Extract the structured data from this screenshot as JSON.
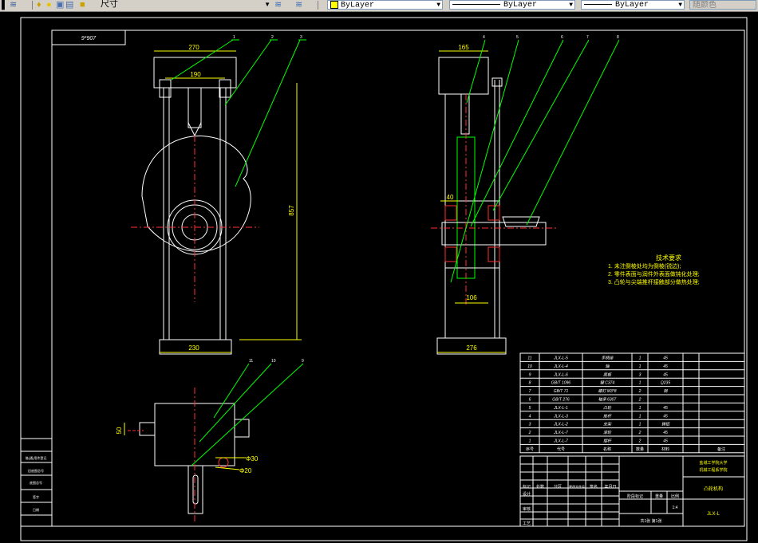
{
  "toolbar": {
    "layer_name": "尺寸",
    "color": "ByLayer",
    "linetype": "ByLayer",
    "lineweight": "ByLayer",
    "plotstyle": "随颜色"
  },
  "drawing": {
    "sheet_label": "9*907",
    "dims": {
      "front_width_top": "270",
      "front_inner": "190",
      "front_height": "857",
      "front_base": "230",
      "side_top": "165",
      "side_shaft": "40",
      "side_lower": "106",
      "side_base": "276",
      "bottom_left": "50",
      "bottom_d30": "Φ30",
      "bottom_d20": "Φ20"
    },
    "balloons_front": [
      "1",
      "2",
      "3"
    ],
    "balloons_side": [
      "4",
      "5",
      "6",
      "7",
      "8"
    ],
    "balloons_bottom": [
      "11",
      "10",
      "9"
    ],
    "notes_title": "技术要求",
    "notes": [
      "1. 未注倒棱处均为倒棱(锐边);",
      "2. 零件表面与润件外表面做钝化处理;",
      "3. 凸轮与尖端推杆接触部分做热处理;"
    ],
    "parts": [
      [
        "11",
        "JLX-L-5",
        "手柄座",
        "1",
        "45"
      ],
      [
        "10",
        "JLX-L-4",
        "轴",
        "1",
        "45"
      ],
      [
        "9",
        "JLX-L-6",
        "底板",
        "3",
        "45"
      ],
      [
        "8",
        "GB/T 1096",
        "键 C374",
        "1",
        "Q235"
      ],
      [
        "7",
        "GB/T 71",
        "螺钉 M3*8",
        "2",
        "钢"
      ],
      [
        "6",
        "GB/T 276",
        "轴承 6307",
        "2",
        ""
      ],
      [
        "5",
        "JLX-L-1",
        "凸轮",
        "1",
        "45"
      ],
      [
        "4",
        "JLX-L-3",
        "推杆",
        "1",
        "45"
      ],
      [
        "3",
        "JLX-L-2",
        "支架",
        "1",
        "铸铝"
      ],
      [
        "2",
        "JLX-L-7",
        "滚轮",
        "2",
        "45"
      ],
      [
        "1",
        "JLX-L-7",
        "摆杆",
        "2",
        "45"
      ]
    ],
    "parts_header": [
      "序号",
      "代号",
      "名称",
      "数量",
      "材料",
      "",
      "备注"
    ],
    "title_left": [
      "标记",
      "处数",
      "分区",
      "更改文件号",
      "签名",
      "年月日"
    ],
    "title_rows": [
      "设计",
      "审核",
      "工艺"
    ],
    "school": "盐城工学院大学",
    "school2": "机械工程系学院",
    "drawing_name": "凸轮机构",
    "drawing_code": "JLX-L",
    "stage": "阶段标记",
    "weight": "重量",
    "scale": "比例",
    "scale_val": "1:4",
    "sheets": "共1张 第1张",
    "left_strip": [
      "借(通)用件登记",
      "旧底图总号",
      "底图总号",
      "签字",
      "日期"
    ]
  }
}
